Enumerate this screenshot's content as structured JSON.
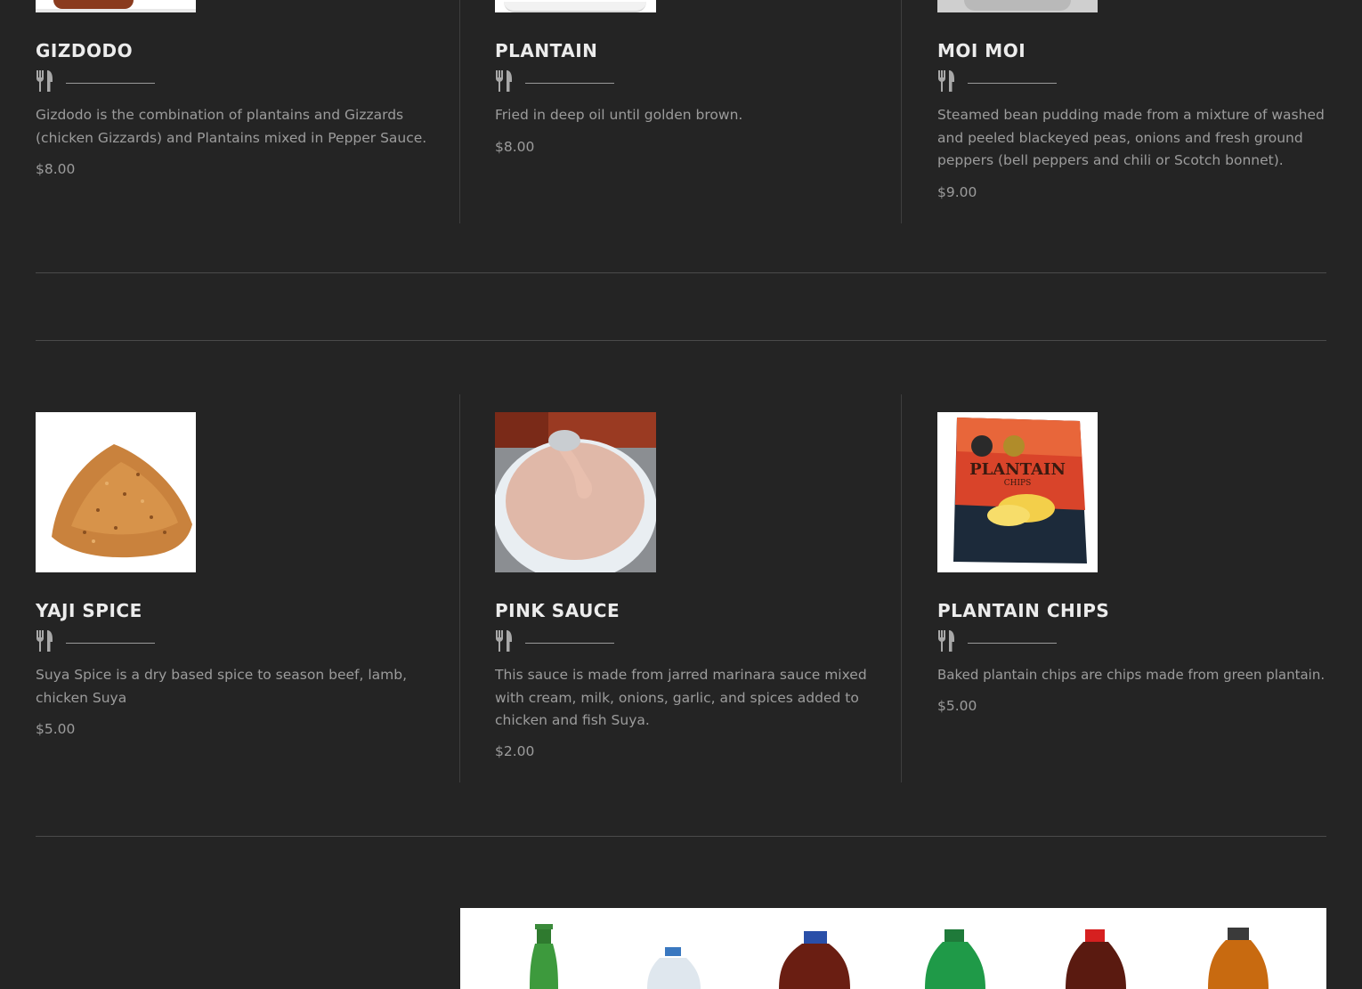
{
  "menu": {
    "row1": [
      {
        "title": "GIZDODO",
        "description": "Gizdodo is the combination of plantains and Gizzards (chicken Gizzards) and Plantains mixed in Pepper Sauce.",
        "price": "$8.00"
      },
      {
        "title": "PLANTAIN",
        "description": "Fried in deep oil until golden brown.",
        "price": "$8.00"
      },
      {
        "title": "MOI MOI",
        "description": "Steamed bean pudding made from a mixture of washed and peeled blackeyed peas, onions and fresh ground peppers (bell peppers and chili or Scotch bonnet).",
        "price": "$9.00"
      }
    ],
    "row2": [
      {
        "title": "YAJI SPICE",
        "description": "Suya Spice is a dry based spice to season beef, lamb, chicken Suya",
        "price": "$5.00"
      },
      {
        "title": "PINK SAUCE",
        "description": "This sauce is made from jarred marinara sauce mixed with cream, milk, onions, garlic, and spices added to chicken and fish Suya.",
        "price": "$2.00"
      },
      {
        "title": "PLANTAIN CHIPS",
        "description": "Baked plantain chips are chips made from green plantain.",
        "price": "$5.00"
      }
    ]
  },
  "icons": {
    "utensils": "fork-knife-icon"
  },
  "colors": {
    "background": "#242424",
    "title": "#ececec",
    "text": "#9c9c9c",
    "divider": "#4a4a4a"
  }
}
